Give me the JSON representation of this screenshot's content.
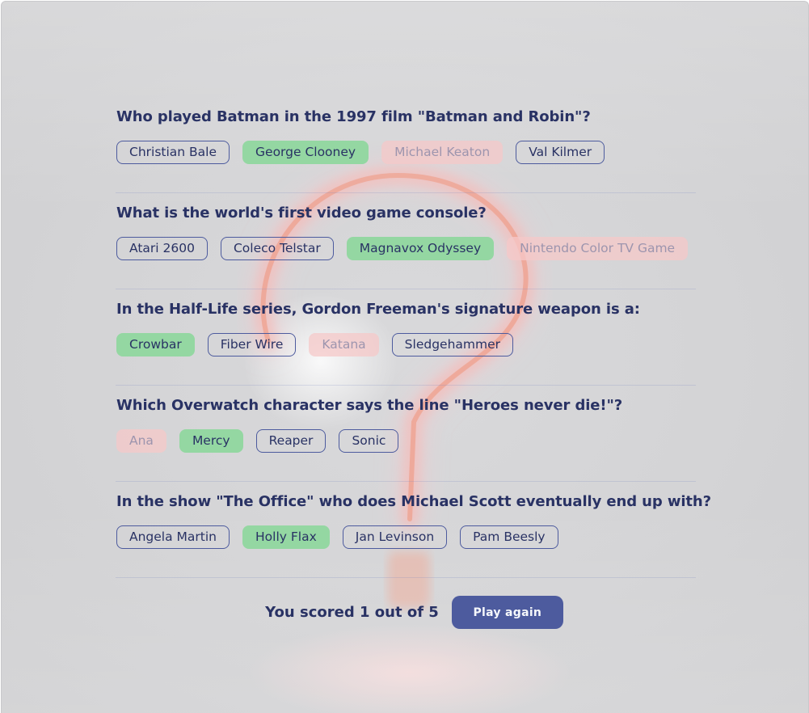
{
  "questions": [
    {
      "text": "Who played Batman in the 1997 film \"Batman and Robin\"?",
      "answers": [
        {
          "label": "Christian Bale",
          "state": "neutral"
        },
        {
          "label": "George Clooney",
          "state": "correct"
        },
        {
          "label": "Michael Keaton",
          "state": "wrong"
        },
        {
          "label": "Val Kilmer",
          "state": "neutral"
        }
      ]
    },
    {
      "text": "What is the world's first video game console?",
      "answers": [
        {
          "label": "Atari 2600",
          "state": "neutral"
        },
        {
          "label": "Coleco Telstar",
          "state": "neutral"
        },
        {
          "label": "Magnavox Odyssey",
          "state": "correct"
        },
        {
          "label": "Nintendo Color TV Game",
          "state": "wrong"
        }
      ]
    },
    {
      "text": "In the Half-Life series, Gordon Freeman's signature weapon is a:",
      "answers": [
        {
          "label": "Crowbar",
          "state": "correct"
        },
        {
          "label": "Fiber Wire",
          "state": "neutral"
        },
        {
          "label": "Katana",
          "state": "wrong"
        },
        {
          "label": "Sledgehammer",
          "state": "neutral"
        }
      ]
    },
    {
      "text": "Which Overwatch character says the line \"Heroes never die!\"?",
      "answers": [
        {
          "label": "Ana",
          "state": "wrong"
        },
        {
          "label": "Mercy",
          "state": "correct"
        },
        {
          "label": "Reaper",
          "state": "neutral"
        },
        {
          "label": "Sonic",
          "state": "neutral"
        }
      ]
    },
    {
      "text": "In the show \"The Office\" who does Michael Scott eventually end up with?",
      "answers": [
        {
          "label": "Angela Martin",
          "state": "neutral"
        },
        {
          "label": "Holly Flax",
          "state": "correct"
        },
        {
          "label": "Jan Levinson",
          "state": "neutral"
        },
        {
          "label": "Pam Beesly",
          "state": "neutral"
        }
      ]
    }
  ],
  "footer": {
    "score_text": "You scored 1 out of 5",
    "play_again_label": "Play again"
  },
  "colors": {
    "text_primary": "#293264",
    "correct": "#94d7a2",
    "wrong": "#f8bcbc",
    "button": "#4d5b9e"
  },
  "background_icon": "question-mark-neon-icon"
}
